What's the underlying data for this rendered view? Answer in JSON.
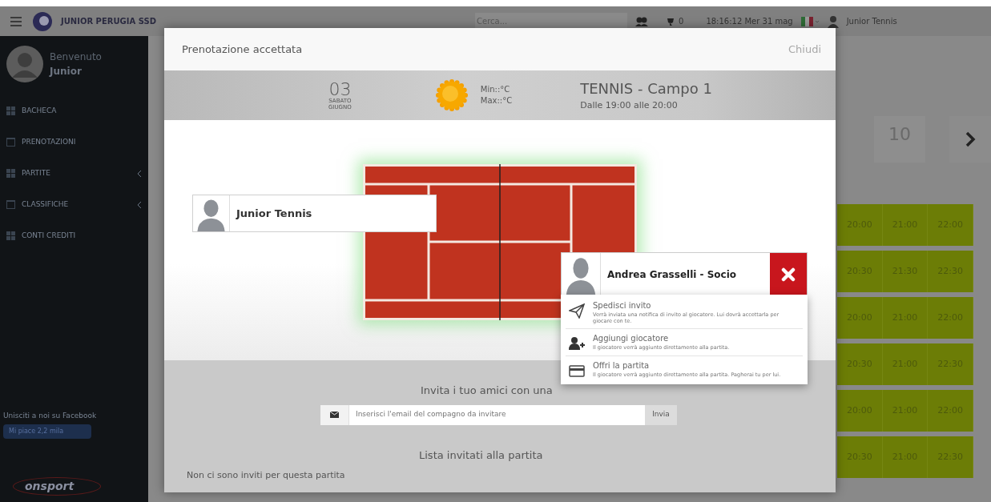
{
  "header": {
    "brand": "JUNIOR PERUGIA SSD",
    "search": {
      "placeholder": "Cerca..."
    },
    "notifications": "0",
    "clock": "18:16:12 Mer 31 mag",
    "user": "Junior Tennis"
  },
  "sidebar": {
    "greeting": "Benvenuto",
    "user": "Junior",
    "items": [
      {
        "label": "BACHECA",
        "has_submenu": false
      },
      {
        "label": "PRENOTAZIONI",
        "has_submenu": false
      },
      {
        "label": "PARTITE",
        "has_submenu": true
      },
      {
        "label": "CLASSIFICHE",
        "has_submenu": true
      },
      {
        "label": "CONTI CREDITI",
        "has_submenu": false
      }
    ],
    "facebook_text": "Unisciti a noi su Facebook",
    "like_button": "Mi piace 2,2 mila",
    "logo": "onsport"
  },
  "schedule": {
    "date_tile": "10",
    "rows": [
      [
        "20:00",
        "21:00",
        "22:00"
      ],
      [
        "20:30",
        "21:30",
        "22:30"
      ],
      [
        "20:00",
        "21:00",
        "22:00"
      ],
      [
        "20:30",
        "21:00",
        "22:30"
      ],
      [
        "20:00",
        "21:00",
        "22:00"
      ],
      [
        "20:30",
        "21:00",
        "22:30"
      ]
    ]
  },
  "modal": {
    "title": "Prenotazione accettata",
    "close": "Chiudi",
    "day": "03",
    "weekday": "SABATO",
    "month": "GIUGNO",
    "min": "Min::°C",
    "max": "Max::°C",
    "court": "TENNIS - Campo 1",
    "time": "Dalle 19:00 alle 20:00",
    "player": "Junior Tennis",
    "invitee": {
      "name": "Andrea Grasselli - Socio",
      "options": [
        {
          "title": "Spedisci invito",
          "description": "Verrà inviata una notifica di invito al giocatore. Lui dovrà accettarla per giocare con te."
        },
        {
          "title": "Aggiungi giocatore",
          "description": "Il giocatore verrà aggiunto direttamente alla partita."
        },
        {
          "title": "Offri la partita",
          "description": "Il giocatore verrà aggiunto direttamente alla partita. Pagherai tu per lui."
        }
      ]
    },
    "invite_prompt": "Invita i tuo amici con una",
    "email": {
      "placeholder": "Inserisci l'email del compagno da invitare"
    },
    "send": "Invia",
    "list_title": "Lista invitati alla partita",
    "empty": "Non ci sono inviti per questa partita"
  }
}
